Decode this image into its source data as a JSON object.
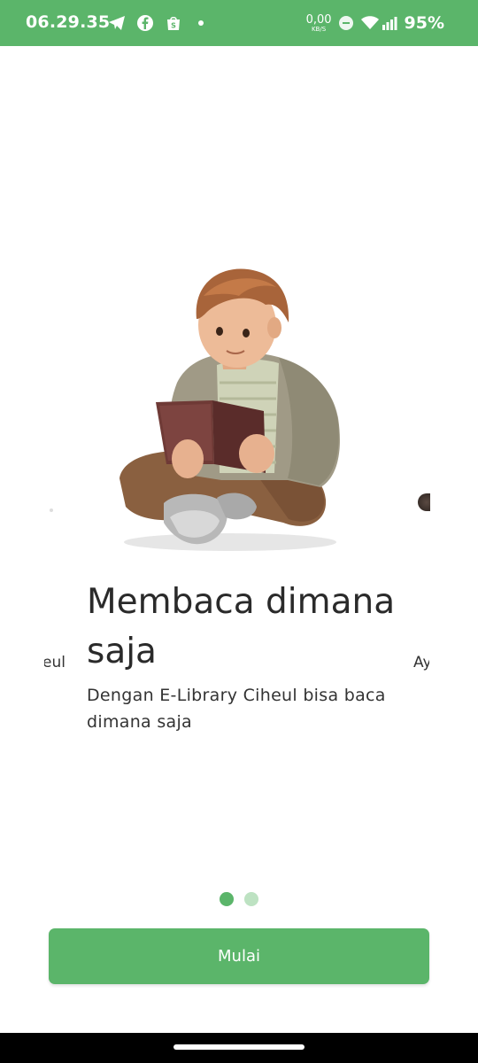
{
  "status_bar": {
    "time": "06.29.35",
    "net_speed_value": "0,00",
    "net_speed_unit": "KB/S",
    "battery": "95%",
    "icons": [
      "telegram-icon",
      "facebook-icon",
      "shopee-icon",
      "notification-dot-icon",
      "dnd-icon",
      "wifi-icon",
      "signal-icon"
    ]
  },
  "slide": {
    "title": "Membaca dimana saja",
    "description": "Dengan E-Library Ciheul bisa baca dimana saja",
    "illustration": "boy-reading-book-illustration",
    "prev_peek_text": "eul",
    "next_peek_text": "Ay"
  },
  "pager": {
    "count": 2,
    "active_index": 0
  },
  "start_button": {
    "label": "Mulai"
  },
  "colors": {
    "primary": "#5bb56a",
    "dot_inactive": "#bde2c2",
    "text": "#2a2a2a"
  }
}
